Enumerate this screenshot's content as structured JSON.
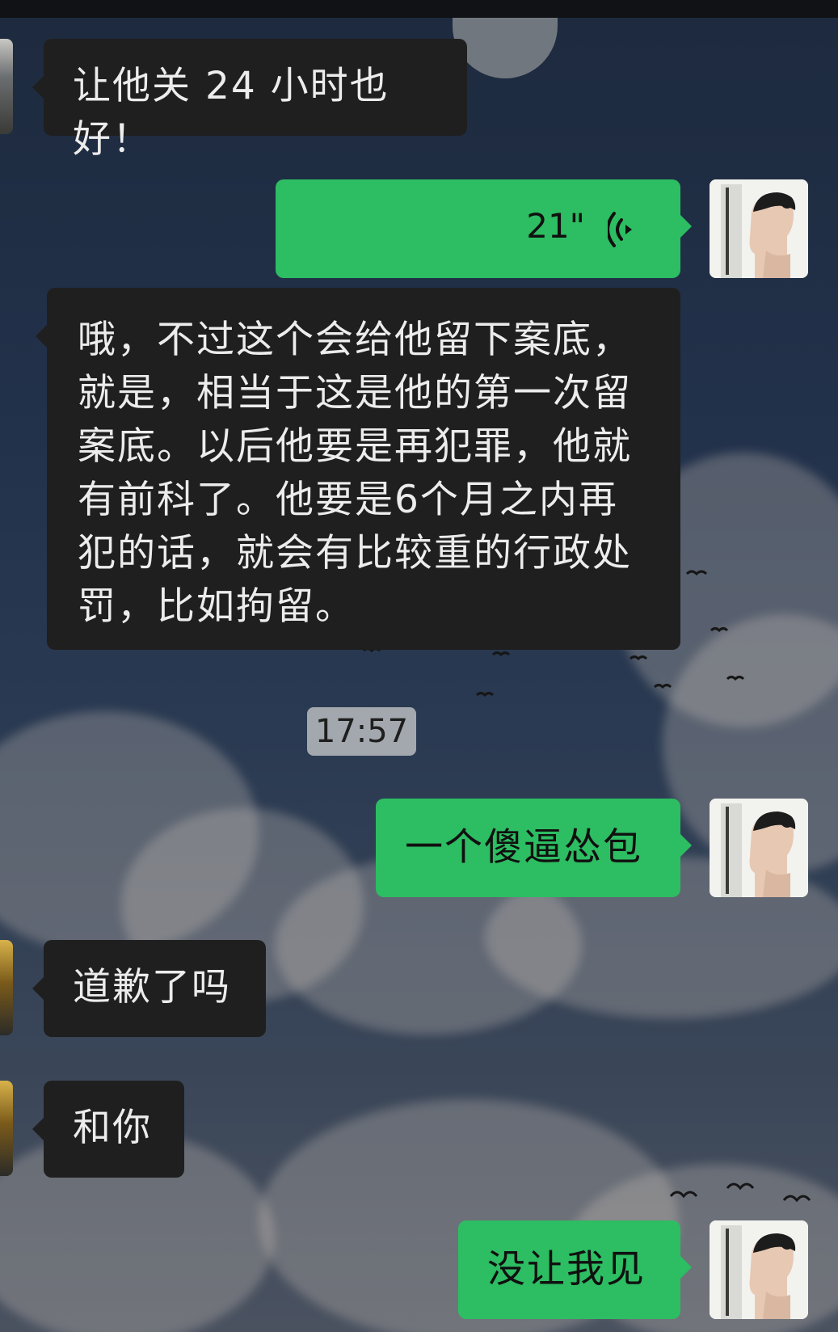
{
  "messages": [
    {
      "side": "in",
      "text": "让他关 24 小时也好！"
    },
    {
      "side": "out",
      "type": "voice",
      "duration": "21\""
    },
    {
      "side": "in",
      "text": "哦，不过这个会给他留下案底，就是，相当于这是他的第一次留案底。以后他要是再犯罪，他就有前科了。他要是6个月之内再犯的话，就会有比较重的行政处罚，比如拘留。"
    },
    {
      "side": "out",
      "text": "一个傻逼怂包"
    },
    {
      "side": "in",
      "text": "道歉了吗"
    },
    {
      "side": "in",
      "text": "和你"
    },
    {
      "side": "out",
      "text": "没让我见"
    }
  ],
  "timestamp": "17:57",
  "long_message_lines": [
    "哦，不过这个会给他留下案底，",
    "就是，相当于这是他的第一次留",
    "案底。以后他要是再犯罪，他就",
    "有前科了。他要是6个月之内再",
    "犯的话，就会有比较重的行政处",
    "罚，比如拘留。"
  ],
  "colors": {
    "outgoing_bubble": "#2dbd62",
    "incoming_bubble": "#1f1f1f",
    "timestamp_bg": "#a3a8ae"
  }
}
